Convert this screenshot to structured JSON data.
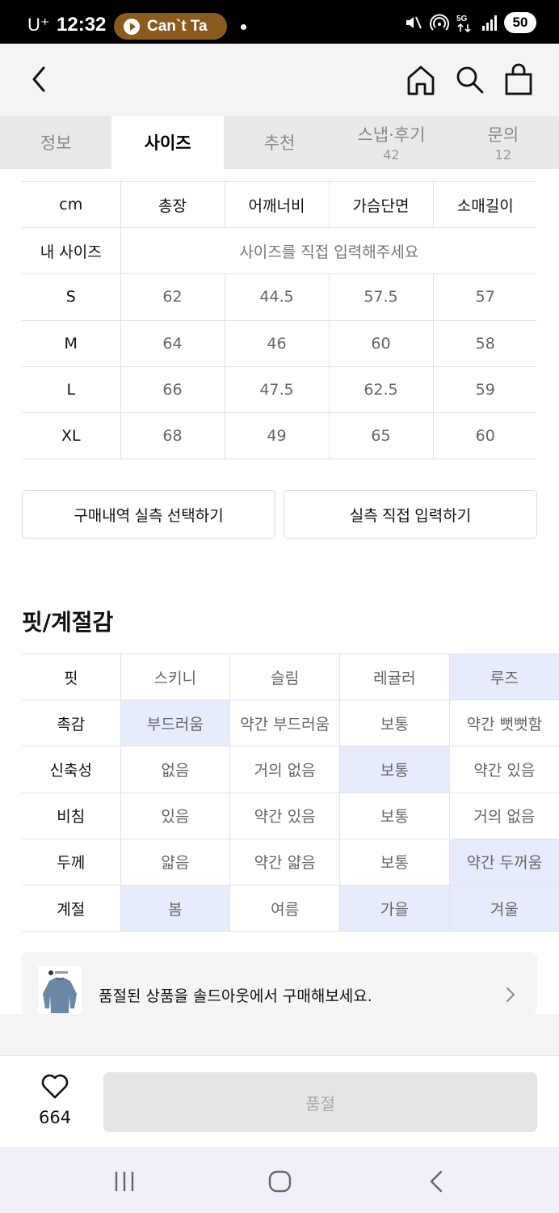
{
  "status_bar": {
    "carrier": "U⁺",
    "time": "12:32",
    "media_label": "Can`t Ta",
    "battery": "50",
    "icons": [
      "mute-icon",
      "hotspot-icon",
      "5g-icon",
      "signal-icon",
      "battery-icon"
    ]
  },
  "header": {
    "icons": [
      "back-arrow-icon",
      "home-icon",
      "search-icon",
      "shopping-bag-icon"
    ]
  },
  "tabs": [
    {
      "label": "정보",
      "count": ""
    },
    {
      "label": "사이즈",
      "count": ""
    },
    {
      "label": "추천",
      "count": ""
    },
    {
      "label": "스냅·후기",
      "count": "42"
    },
    {
      "label": "문의",
      "count": "12"
    }
  ],
  "active_tab": "사이즈",
  "size_table": {
    "unit": "cm",
    "columns": [
      "총장",
      "어깨너비",
      "가슴단면",
      "소매길이"
    ],
    "my_size_label": "내 사이즈",
    "my_size_placeholder": "사이즈를 직접 입력해주세요",
    "rows": [
      {
        "size": "S",
        "values": [
          "62",
          "44.5",
          "57.5",
          "57"
        ]
      },
      {
        "size": "M",
        "values": [
          "64",
          "46",
          "60",
          "58"
        ]
      },
      {
        "size": "L",
        "values": [
          "66",
          "47.5",
          "62.5",
          "59"
        ]
      },
      {
        "size": "XL",
        "values": [
          "68",
          "49",
          "65",
          "60"
        ]
      }
    ]
  },
  "buttons": {
    "purchase_history": "구매내역 실측 선택하기",
    "manual_input": "실측 직접 입력하기"
  },
  "fit_section": {
    "title": "핏/계절감",
    "rows": [
      {
        "label": "핏",
        "options": [
          "스키니",
          "슬림",
          "레귤러",
          "루즈"
        ],
        "selected": [
          false,
          false,
          false,
          true
        ]
      },
      {
        "label": "촉감",
        "options": [
          "부드러움",
          "약간 부드러움",
          "보통",
          "약간 뻣뻣함"
        ],
        "selected": [
          true,
          false,
          false,
          false
        ]
      },
      {
        "label": "신축성",
        "options": [
          "없음",
          "거의 없음",
          "보통",
          "약간 있음"
        ],
        "selected": [
          false,
          false,
          true,
          false
        ]
      },
      {
        "label": "비침",
        "options": [
          "있음",
          "약간 있음",
          "보통",
          "거의 없음"
        ],
        "selected": [
          false,
          false,
          false,
          false
        ]
      },
      {
        "label": "두께",
        "options": [
          "얇음",
          "약간 얇음",
          "보통",
          "약간 두꺼움"
        ],
        "selected": [
          false,
          false,
          false,
          true
        ]
      },
      {
        "label": "계절",
        "options": [
          "봄",
          "여름",
          "가을",
          "겨울"
        ],
        "selected": [
          true,
          false,
          true,
          true
        ]
      }
    ],
    "highlight_color": "#e6ecfb"
  },
  "soldout_banner": {
    "text": "품절된 상품을 솔드아웃에서 구매해보세요."
  },
  "bottom_bar": {
    "like_count": "664",
    "soldout_label": "품절"
  }
}
